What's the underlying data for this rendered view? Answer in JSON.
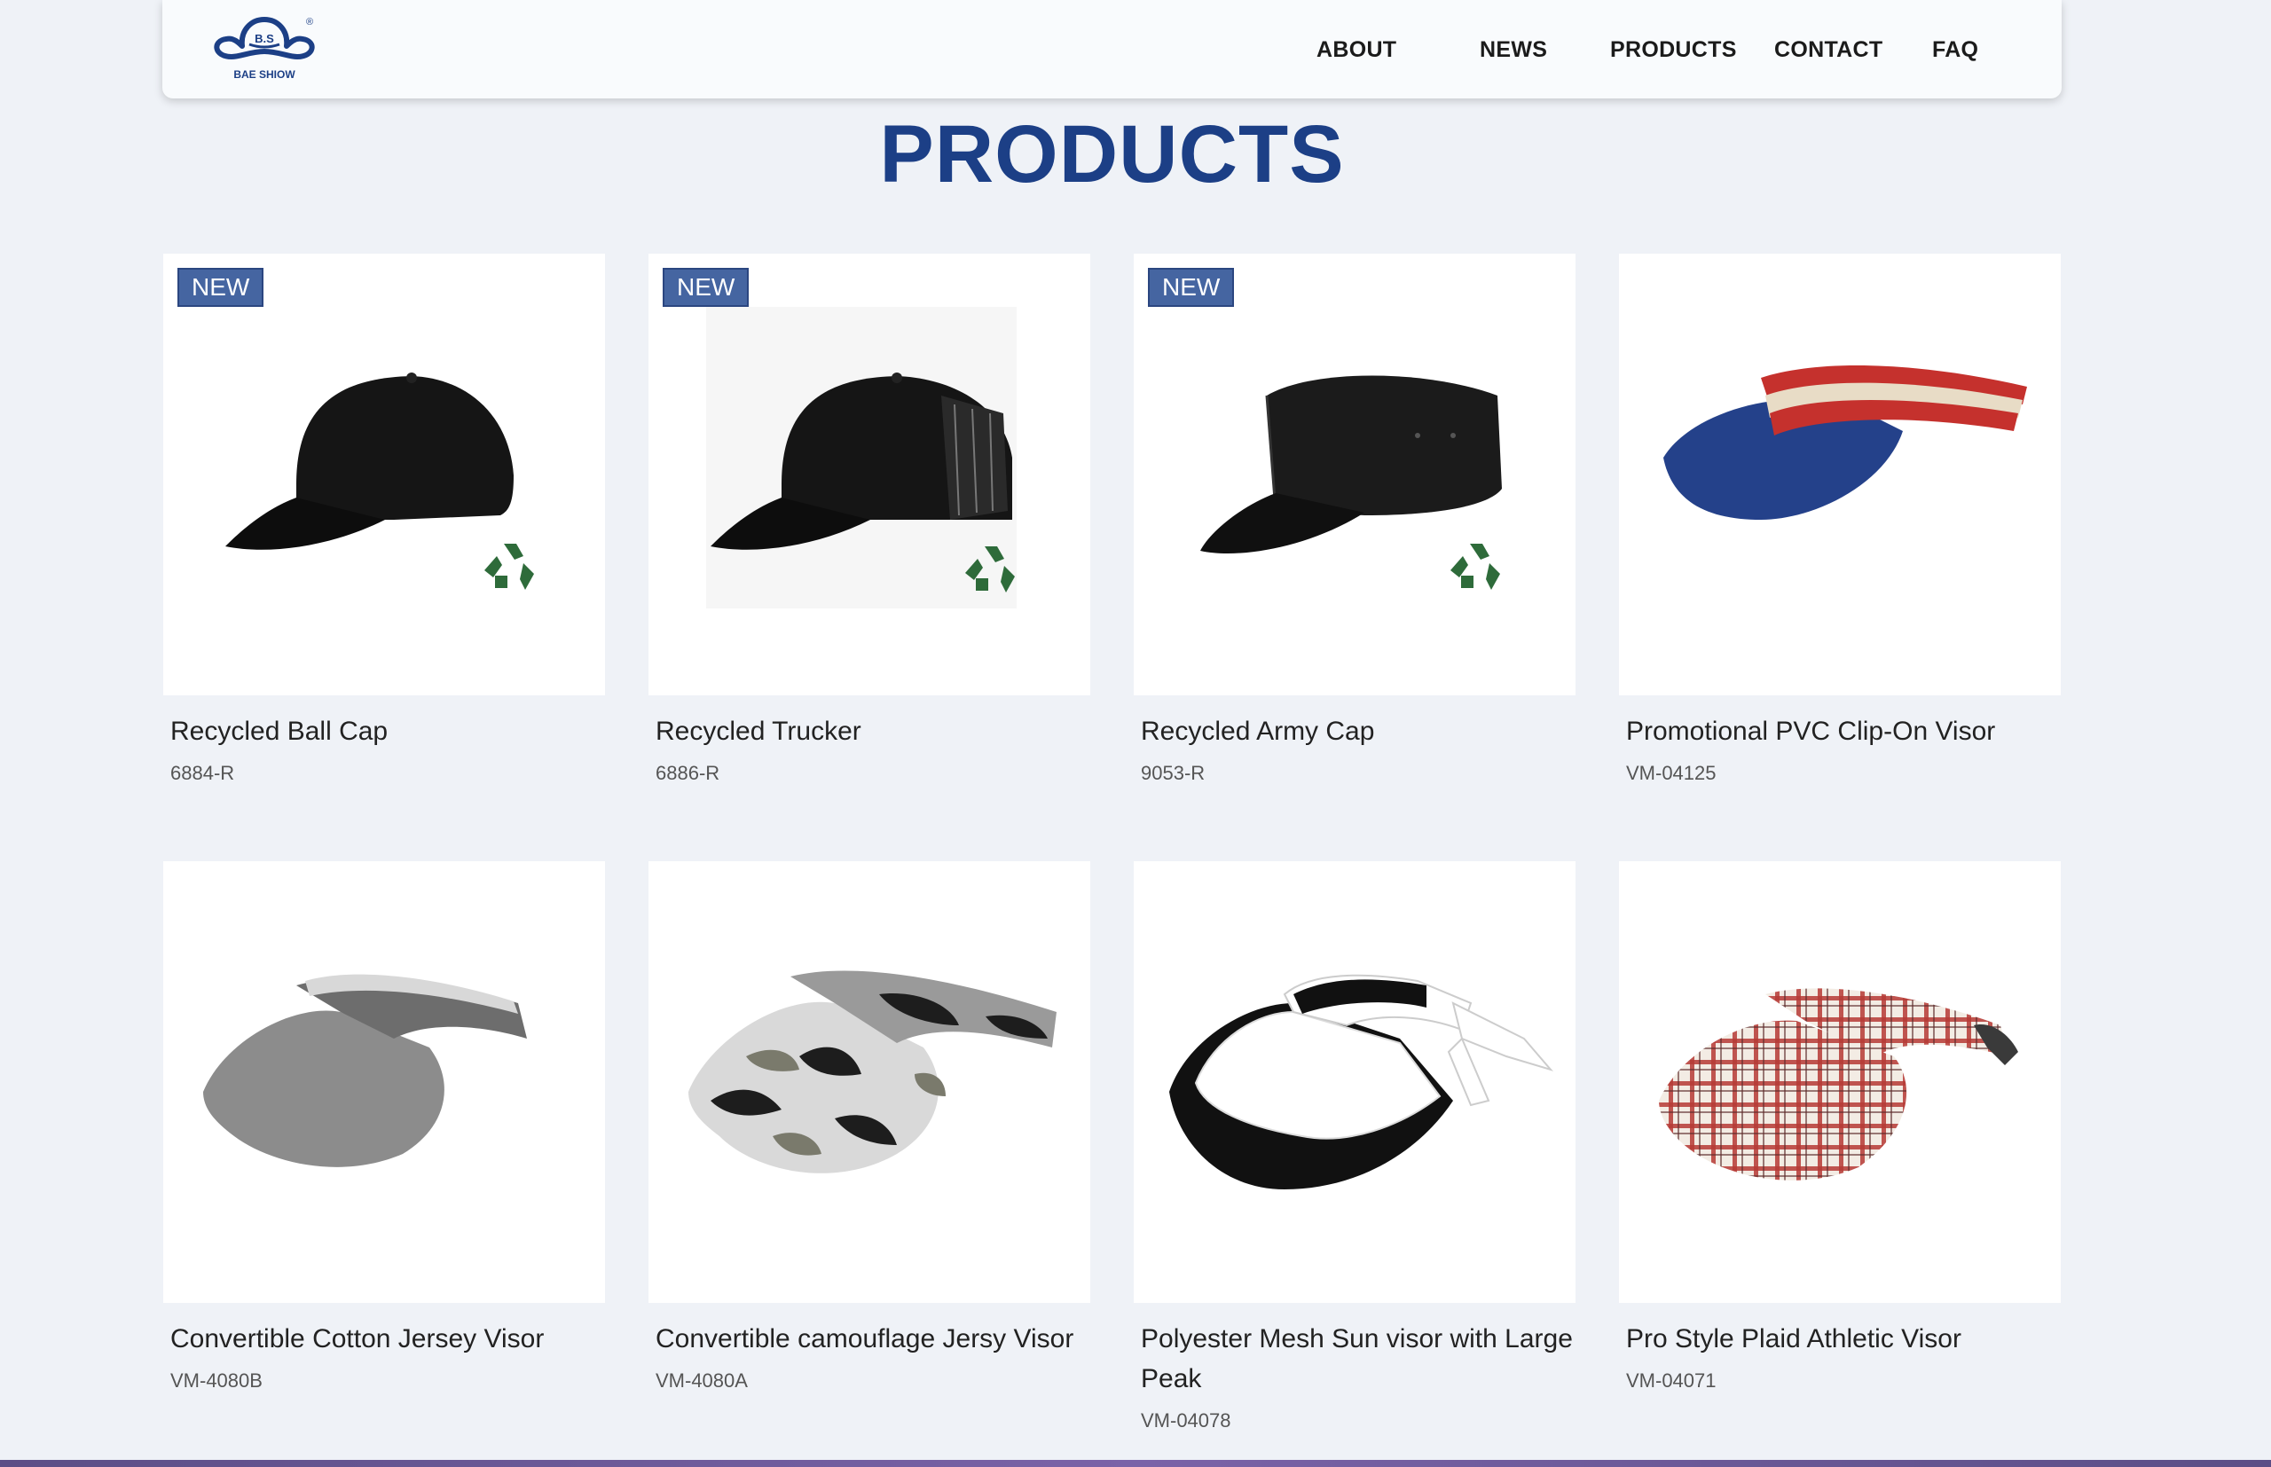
{
  "brand": {
    "logo_text": "B.S",
    "logo_name": "BAE SHIOW",
    "registered": "®"
  },
  "nav": {
    "about": "ABOUT",
    "news": "NEWS",
    "products": "PRODUCTS",
    "contact": "CONTACT",
    "faq": "FAQ"
  },
  "page": {
    "title": "PRODUCTS"
  },
  "products": [
    {
      "name": "Recycled Ball Cap",
      "code": "6884-R",
      "badge": "NEW",
      "icon": "black-ball-cap"
    },
    {
      "name": "Recycled Trucker",
      "code": "6886-R",
      "badge": "NEW",
      "icon": "black-trucker-cap"
    },
    {
      "name": "Recycled Army Cap",
      "code": "9053-R",
      "badge": "NEW",
      "icon": "black-army-cap"
    },
    {
      "name": "Promotional PVC Clip-On Visor",
      "code": "VM-04125",
      "badge": "",
      "icon": "blue-clip-on-visor"
    },
    {
      "name": "Convertible Cotton Jersey Visor",
      "code": "VM-4080B",
      "badge": "",
      "icon": "grey-jersey-visor"
    },
    {
      "name": "Convertible camouflage Jersy Visor",
      "code": "VM-4080A",
      "badge": "",
      "icon": "camouflage-visor"
    },
    {
      "name": "Polyester Mesh Sun visor with Large Peak",
      "code": "VM-04078",
      "badge": "",
      "icon": "white-black-sun-visor"
    },
    {
      "name": "Pro Style Plaid Athletic Visor",
      "code": "VM-04071",
      "badge": "",
      "icon": "plaid-visor"
    }
  ],
  "colors": {
    "accent": "#1c3f86",
    "badge": "#4565a1",
    "background": "#eff2f7",
    "recycle": "#2e6b3a"
  }
}
